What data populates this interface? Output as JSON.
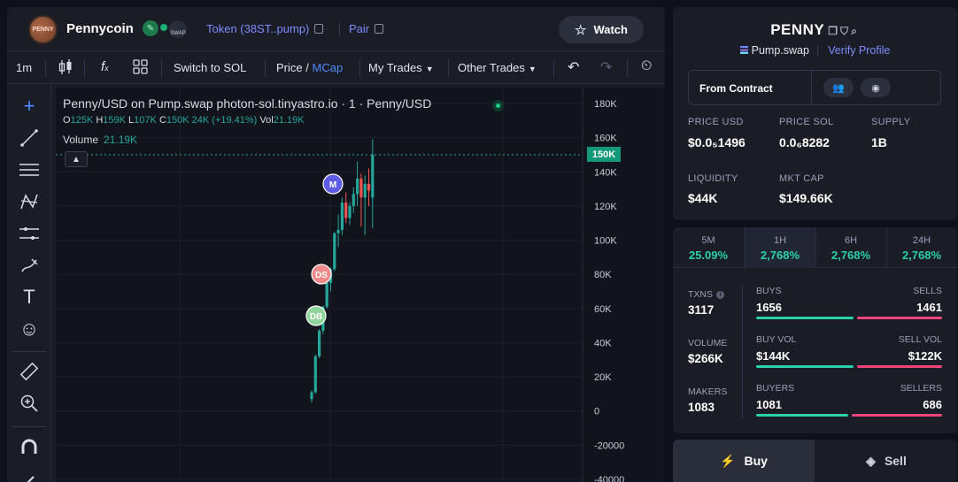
{
  "header": {
    "coin_logo_text": "PENNY",
    "coin_name": "Pennycoin",
    "swap_badge": "SWAP",
    "token_link": "Token (38ST..pump)",
    "pair_link": "Pair",
    "watch_label": "Watch"
  },
  "toolbar": {
    "interval": "1m",
    "switch_label": "Switch to SOL",
    "price_label": "Price",
    "slash": "/",
    "mcap_label": "MCap",
    "my_trades": "My Trades",
    "other_trades": "Other Trades"
  },
  "chart": {
    "title": "Penny/USD on Pump.swap photon-sol.tinyastro.io · 1 · Penny/USD",
    "ohlc": {
      "o_label": "O",
      "o": "125K",
      "h_label": "H",
      "h": "159K",
      "l_label": "L",
      "l": "107K",
      "c_label": "C",
      "c": "150K",
      "change": "24K (+19.41%)",
      "vol_label": "Vol",
      "vol": "21.19K"
    },
    "volume_label": "Volume",
    "volume_value": "21.19K",
    "current_price_tag": "150K",
    "markers": {
      "m": "M",
      "ds": "DS",
      "db": "DB"
    }
  },
  "chart_data": {
    "type": "candlestick",
    "y_ticks": [
      "180K",
      "160K",
      "140K",
      "120K",
      "100K",
      "80K",
      "60K",
      "40K",
      "20K",
      "0",
      "-20000",
      "-40000"
    ],
    "ylim": [
      -40000,
      180000
    ],
    "current_price": 150000,
    "candles": [
      {
        "o": 7000,
        "h": 12000,
        "l": 5000,
        "c": 11000
      },
      {
        "o": 11000,
        "h": 33000,
        "l": 10000,
        "c": 32000
      },
      {
        "o": 32000,
        "h": 48000,
        "l": 31000,
        "c": 47000
      },
      {
        "o": 47000,
        "h": 62000,
        "l": 45000,
        "c": 61000
      },
      {
        "o": 61000,
        "h": 76000,
        "l": 60000,
        "c": 75000
      },
      {
        "o": 75000,
        "h": 84000,
        "l": 70000,
        "c": 83000
      },
      {
        "o": 83000,
        "h": 105000,
        "l": 82000,
        "c": 104000
      },
      {
        "o": 104000,
        "h": 115000,
        "l": 96000,
        "c": 106000
      },
      {
        "o": 106000,
        "h": 125000,
        "l": 103000,
        "c": 122000
      },
      {
        "o": 122000,
        "h": 128000,
        "l": 110000,
        "c": 113000
      },
      {
        "o": 113000,
        "h": 122000,
        "l": 109000,
        "c": 120000
      },
      {
        "o": 120000,
        "h": 131000,
        "l": 116000,
        "c": 127000
      },
      {
        "o": 127000,
        "h": 146000,
        "l": 120000,
        "c": 136000
      },
      {
        "o": 136000,
        "h": 139000,
        "l": 108000,
        "c": 125000
      },
      {
        "o": 125000,
        "h": 138000,
        "l": 103000,
        "c": 133000
      },
      {
        "o": 133000,
        "h": 142000,
        "l": 120000,
        "c": 129000
      },
      {
        "o": 125000,
        "h": 159000,
        "l": 107000,
        "c": 150000
      }
    ]
  },
  "token_panel": {
    "ticker": "PENNY",
    "platform": "Pump.swap",
    "verify": "Verify Profile",
    "from_contract": "From Contract",
    "price_usd_label": "PRICE USD",
    "price_usd": "$0.0₅1496",
    "price_sol_label": "PRICE SOL",
    "price_sol": "0.0₆8282",
    "supply_label": "SUPPLY",
    "supply": "1B",
    "liquidity_label": "LIQUIDITY",
    "liquidity": "$44K",
    "mktcap_label": "MKT CAP",
    "mktcap": "$149.66K"
  },
  "stats": {
    "timeframes": [
      {
        "label": "5M",
        "value": "25.09%"
      },
      {
        "label": "1H",
        "value": "2,768%"
      },
      {
        "label": "6H",
        "value": "2,768%"
      },
      {
        "label": "24H",
        "value": "2,768%"
      }
    ],
    "txns_label": "TXNS",
    "txns": "3117",
    "volume_label": "VOLUME",
    "volume": "$266K",
    "makers_label": "MAKERS",
    "makers": "1083",
    "buys_label": "BUYS",
    "buys": "1656",
    "sells_label": "SELLS",
    "sells": "1461",
    "buy_vol_label": "BUY VOL",
    "buy_vol": "$144K",
    "sell_vol_label": "SELL VOL",
    "sell_vol": "$122K",
    "buyers_label": "BUYERS",
    "buyers": "1081",
    "sellers_label": "SELLERS",
    "sellers": "686"
  },
  "trade": {
    "buy_label": "Buy",
    "sell_label": "Sell"
  },
  "colors": {
    "accent": "#7f8cff",
    "green": "#2bd1a8",
    "red": "#f0457a",
    "candle_up": "#26a69a",
    "candle_down": "#ef5350"
  }
}
